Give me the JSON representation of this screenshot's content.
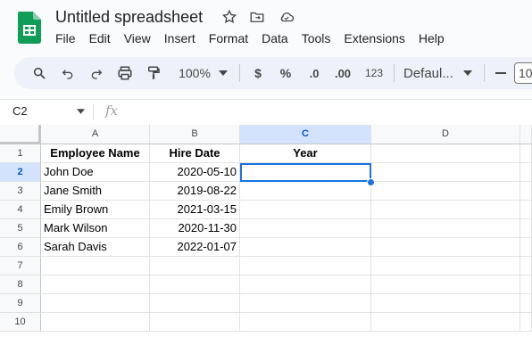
{
  "app": {
    "doc_title": "Untitled spreadsheet",
    "menu": [
      "File",
      "Edit",
      "View",
      "Insert",
      "Format",
      "Data",
      "Tools",
      "Extensions",
      "Help"
    ]
  },
  "toolbar": {
    "zoom": "100%",
    "currency": "$",
    "percent": "%",
    "dec_decrease": ".0",
    "dec_increase": ".00",
    "format_123": "123",
    "font": "Defaul...",
    "minus": "—",
    "font_size": "10"
  },
  "formula_bar": {
    "cell_ref": "C2",
    "fx": "fx",
    "value": ""
  },
  "grid": {
    "columns": [
      "A",
      "B",
      "C",
      "D"
    ],
    "rows": [
      [
        "1",
        "Employee Name",
        "Hire Date",
        "Year",
        ""
      ],
      [
        "2",
        "John Doe",
        "2020-05-10",
        "",
        ""
      ],
      [
        "3",
        "Jane Smith",
        "2019-08-22",
        "",
        ""
      ],
      [
        "4",
        "Emily Brown",
        "2021-03-15",
        "",
        ""
      ],
      [
        "5",
        "Mark Wilson",
        "2020-11-30",
        "",
        ""
      ],
      [
        "6",
        "Sarah Davis",
        "2022-01-07",
        "",
        ""
      ],
      [
        "7",
        "",
        "",
        "",
        ""
      ],
      [
        "8",
        "",
        "",
        "",
        ""
      ],
      [
        "9",
        "",
        "",
        "",
        ""
      ],
      [
        "10",
        "",
        "",
        "",
        ""
      ]
    ],
    "selected_cell": "C2"
  },
  "colors": {
    "accent": "#1a73e8",
    "selection_header": "#d3e3fd",
    "logo_green": "#0f9d58"
  }
}
